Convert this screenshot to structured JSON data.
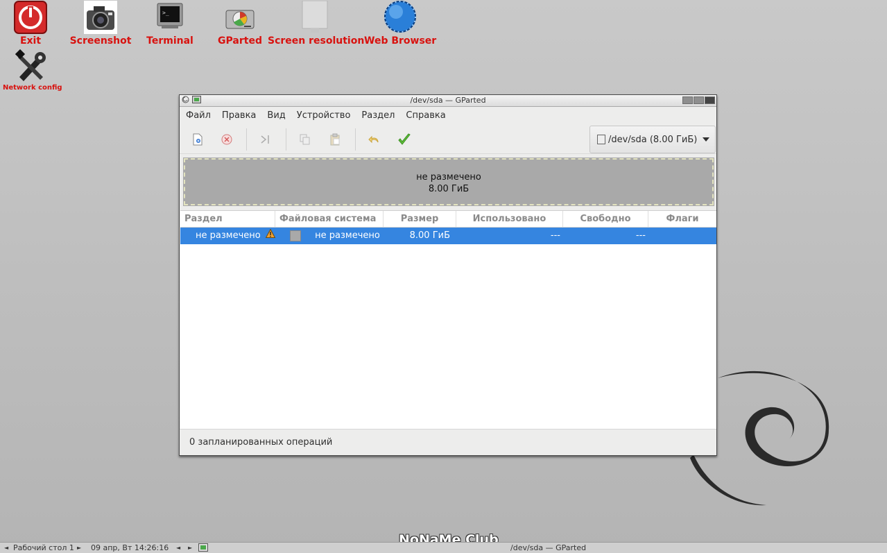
{
  "desktop": {
    "icons": [
      {
        "label": "Exit",
        "icon": "power-icon"
      },
      {
        "label": "Screenshot",
        "icon": "camera-icon"
      },
      {
        "label": "Terminal",
        "icon": "terminal-icon"
      },
      {
        "label": "GParted",
        "icon": "disk-icon"
      },
      {
        "label": "Screen resolution",
        "icon": "monitor-icon"
      },
      {
        "label": "Web Browser",
        "icon": "globe-icon"
      },
      {
        "label": "Network config",
        "icon": "tools-icon"
      }
    ],
    "label_color": "#d8120f"
  },
  "window": {
    "title": "/dev/sda — GParted",
    "menu": [
      "Файл",
      "Правка",
      "Вид",
      "Устройство",
      "Раздел",
      "Справка"
    ],
    "device_selector": "/dev/sda (8.00 ГиБ)",
    "disk_map": {
      "label": "не размечено",
      "size": "8.00 ГиБ"
    },
    "table": {
      "headers": [
        "Раздел",
        "Файловая система",
        "Размер",
        "Использовано",
        "Свободно",
        "Флаги"
      ],
      "rows": [
        {
          "partition": "не размечено",
          "filesystem": "не размечено",
          "size": "8.00 ГиБ",
          "used": "---",
          "free": "---",
          "flags": ""
        }
      ],
      "selected_color": "#3585e0"
    },
    "status": "0 запланированных операций"
  },
  "taskbar": {
    "desktop": "Рабочий стол 1",
    "clock": "09 апр, Вт 14:26:16",
    "task": "/dev/sda — GParted"
  },
  "watermark": "NoNaMe Club"
}
